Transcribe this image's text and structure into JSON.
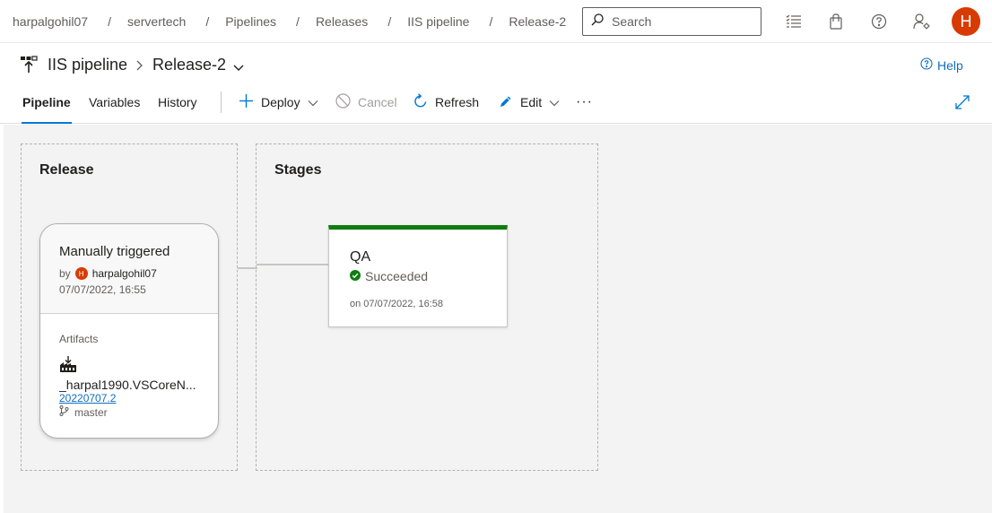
{
  "breadcrumb": [
    {
      "label": "harpalgohil07"
    },
    {
      "label": "servertech"
    },
    {
      "label": "Pipelines"
    },
    {
      "label": "Releases"
    },
    {
      "label": "IIS pipeline"
    },
    {
      "label": "Release-2"
    }
  ],
  "search": {
    "placeholder": "Search"
  },
  "user": {
    "avatar_initial": "H",
    "avatar_color": "#d83b01"
  },
  "header": {
    "pipeline_name": "IIS pipeline",
    "release_name": "Release-2",
    "help_label": "Help"
  },
  "tabs": [
    {
      "label": "Pipeline",
      "active": true
    },
    {
      "label": "Variables",
      "active": false
    },
    {
      "label": "History",
      "active": false
    }
  ],
  "toolbar": {
    "deploy_label": "Deploy",
    "cancel_label": "Cancel",
    "refresh_label": "Refresh",
    "edit_label": "Edit",
    "more_label": "···"
  },
  "release_panel": {
    "title": "Release",
    "trigger": "Manually triggered",
    "by_label": "by",
    "user_initial": "H",
    "user": "harpalgohil07",
    "timestamp": "07/07/2022, 16:55",
    "artifacts_label": "Artifacts",
    "artifact_name": "_harpal1990.VSCoreN...",
    "artifact_version": "20220707.2",
    "artifact_branch": "master"
  },
  "stages_panel": {
    "title": "Stages",
    "stage": {
      "name": "QA",
      "status": "Succeeded",
      "date": "on 07/07/2022, 16:58",
      "status_color": "#107c10"
    }
  },
  "colors": {
    "accent": "#0078d4",
    "success": "#107c10"
  }
}
